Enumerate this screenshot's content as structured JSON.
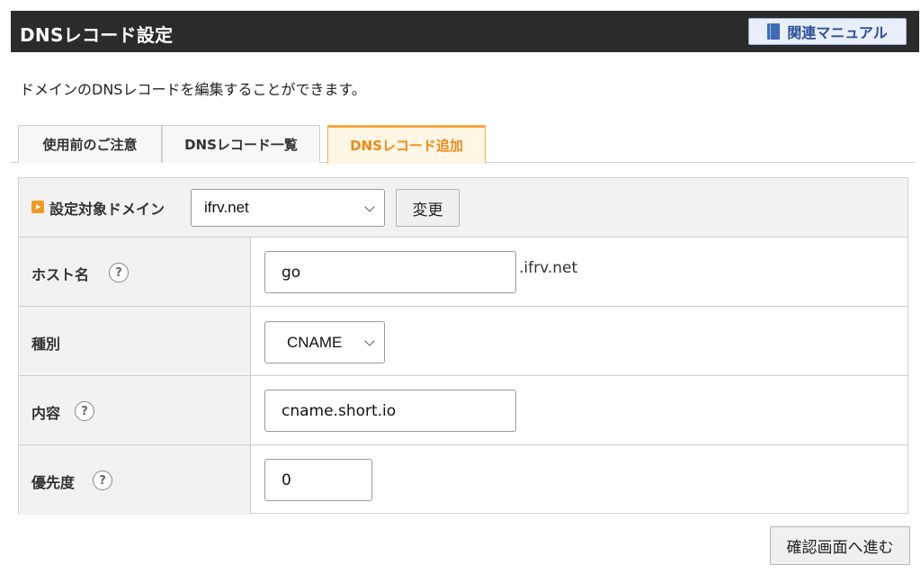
{
  "header": {
    "title": "DNSレコード設定",
    "manual_label": "関連マニュアル"
  },
  "description": "ドメインのDNSレコードを編集することができます。",
  "tabs": [
    {
      "label": "使用前のご注意",
      "active": false
    },
    {
      "label": "DNSレコード一覧",
      "active": false
    },
    {
      "label": "DNSレコード追加",
      "active": true
    }
  ],
  "domain_section": {
    "label": "設定対象ドメイン",
    "selected_domain": "ifrv.net",
    "change_label": "変更"
  },
  "form": {
    "host": {
      "label": "ホスト名",
      "help": "?",
      "value": "go",
      "suffix": ".ifrv.net"
    },
    "type": {
      "label": "種別",
      "selected": "CNAME"
    },
    "content": {
      "label": "内容",
      "help": "?",
      "value": "cname.short.io"
    },
    "priority": {
      "label": "優先度",
      "help": "?",
      "value": "0"
    }
  },
  "confirm_label": "確認画面へ進む",
  "colors": {
    "header_bg": "#2b2b2b",
    "active_tab_text": "#f08a18",
    "accent": "#f29a1d",
    "manual_text": "#2b4f96"
  }
}
